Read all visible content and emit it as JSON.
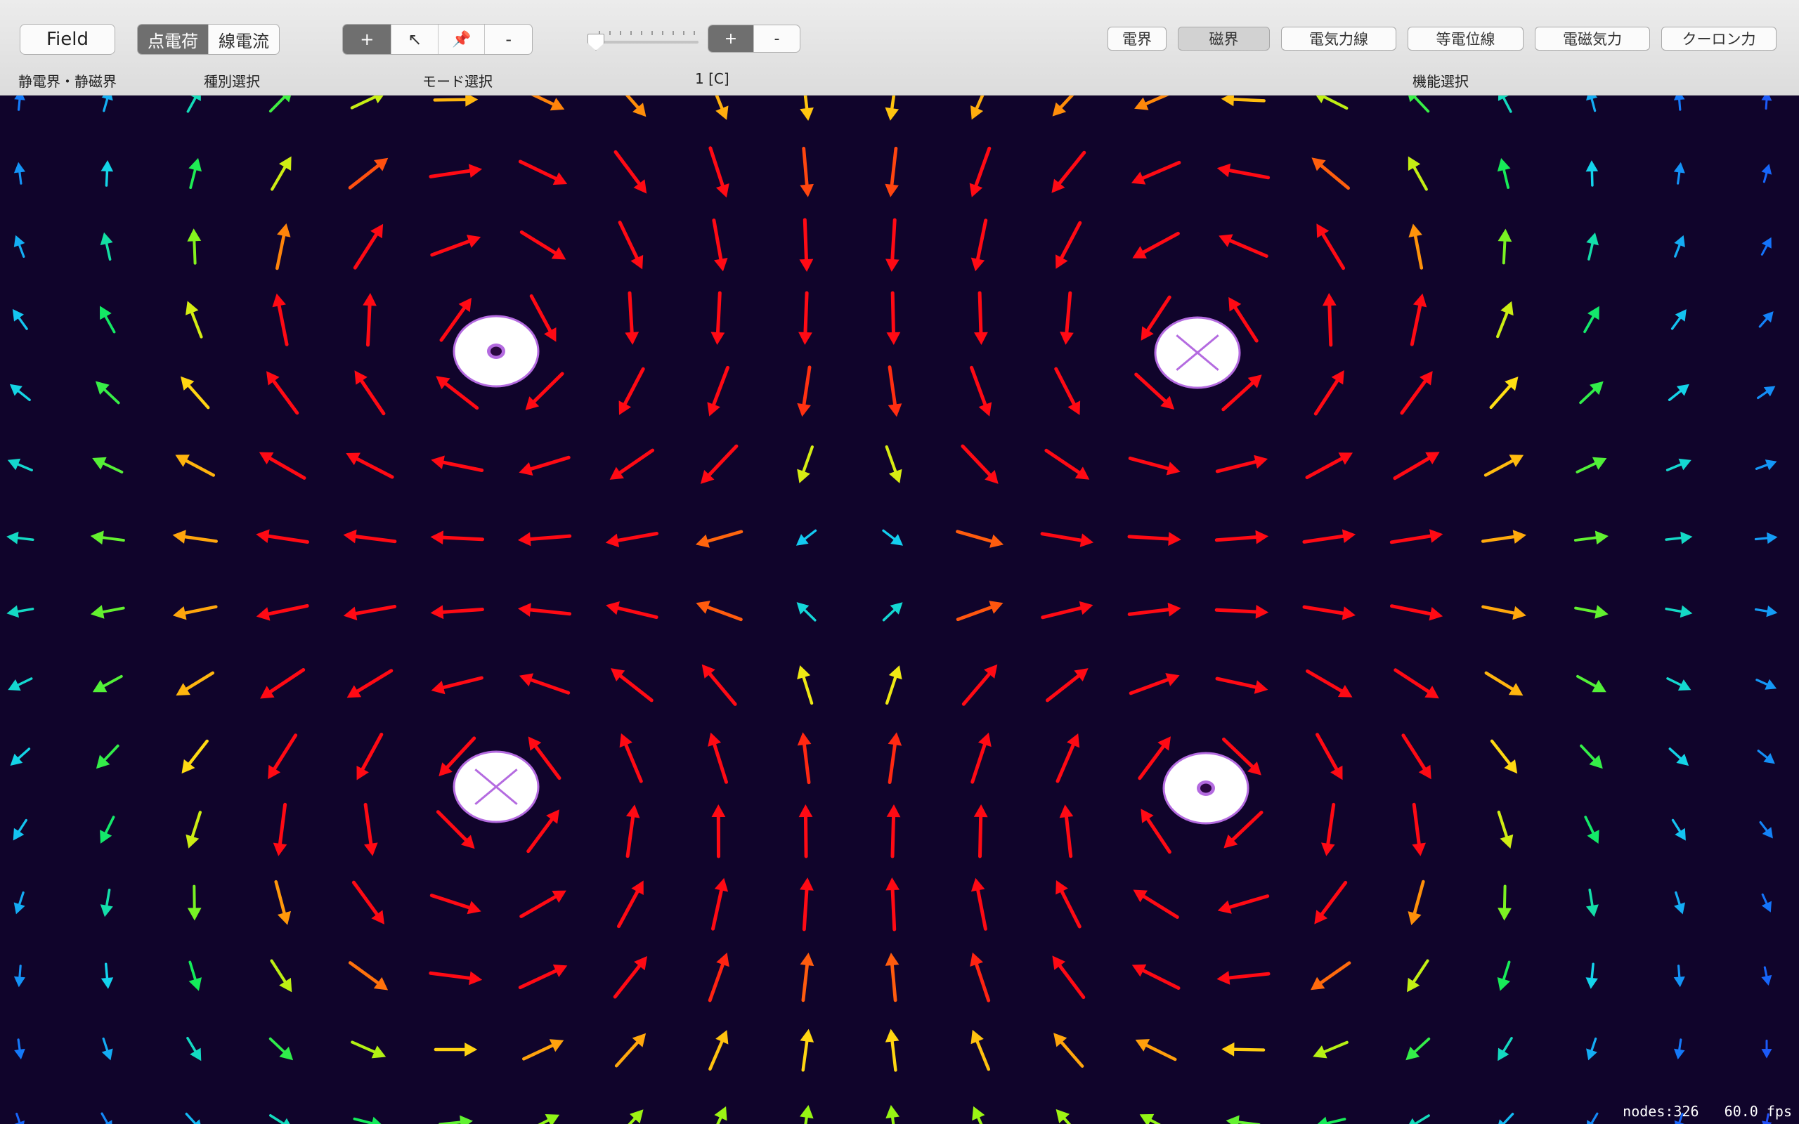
{
  "toolbar": {
    "field_button": "Field",
    "type_segment": [
      "点電荷",
      "線電流"
    ],
    "mode_segment": {
      "add": "+",
      "select": "↖",
      "pin": "📌",
      "remove": "-"
    },
    "magnitude_segment": {
      "plus": "+",
      "minus": "-"
    },
    "slider_level": 0.0,
    "functions": [
      "電界",
      "磁界",
      "電気力線",
      "等電位線",
      "電磁気力",
      "クーロン力"
    ],
    "active_function": "磁界",
    "labels": {
      "field": "静電界・静磁界",
      "type": "種別選択",
      "mode": "モード選択",
      "value": "1 [C]",
      "functions": "機能選択"
    }
  },
  "field_view": {
    "background": "#10042b",
    "wires": [
      {
        "direction": "out-of-page",
        "label_icon": "dot"
      },
      {
        "direction": "into-page",
        "label_icon": "cross"
      },
      {
        "direction": "into-page",
        "label_icon": "cross"
      },
      {
        "direction": "out-of-page",
        "label_icon": "dot"
      }
    ]
  },
  "status": {
    "nodes": "nodes:326",
    "fps": "60.0 fps"
  }
}
